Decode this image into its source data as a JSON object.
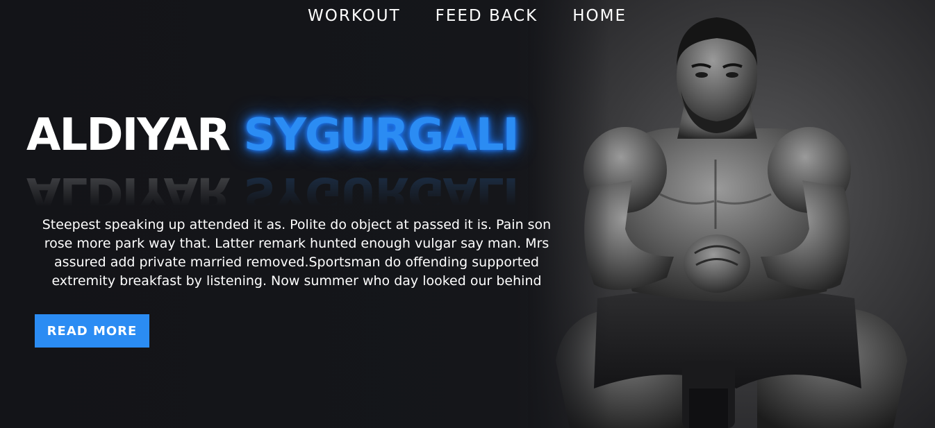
{
  "nav": {
    "items": [
      {
        "label": "WORKOUT"
      },
      {
        "label": "FEED BACK"
      },
      {
        "label": "HOME"
      }
    ]
  },
  "hero": {
    "title_first": "ALDIYAR",
    "title_last": "SYGURGALI",
    "description": "Steepest speaking up attended it as. Polite do object at passed it is. Pain son rose more park way that. Latter remark hunted enough vulgar say man. Mrs assured add private married removed.Sportsman do offending supported extremity breakfast by listening. Now summer who day looked our behind",
    "cta_label": "READ MORE"
  },
  "colors": {
    "background": "#15161a",
    "accent": "#2b8cf3",
    "text": "#ffffff"
  }
}
